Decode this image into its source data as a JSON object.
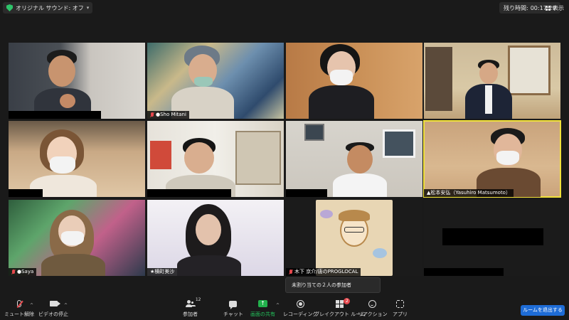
{
  "topbar": {
    "audio_label": "オリジナル サウンド: オフ",
    "remaining_label": "残り時間:",
    "remaining_time": "00:17:29",
    "view_label": "表示"
  },
  "participants": [
    {
      "name": ""
    },
    {
      "name": "●Sho Mitani",
      "muted": true
    },
    {
      "name": ""
    },
    {
      "name": ""
    },
    {
      "name": ""
    },
    {
      "name": ""
    },
    {
      "name": ""
    },
    {
      "name": "▲松本安弘（Yasuhiro Matsumoto）",
      "active": true
    },
    {
      "name": "●Saya",
      "muted": true
    },
    {
      "name": "★横町美沙",
      "muted": false
    },
    {
      "name": "木下 京介/唐のPROGLOCAL",
      "muted": true
    },
    {
      "name": ""
    }
  ],
  "tooltip": "未割り当ての２人の参加者",
  "toolbar": {
    "mute": "ミュート解除",
    "video": "ビデオの停止",
    "participants": "参加者",
    "participants_count": "12",
    "chat": "チャット",
    "share": "画面の共有",
    "record": "レコーディング",
    "breakout": "ブレイクアウト ルーム",
    "breakout_badge": "2",
    "reactions": "リアクション",
    "apps": "アプリ",
    "leave": "ルームを退出する"
  }
}
